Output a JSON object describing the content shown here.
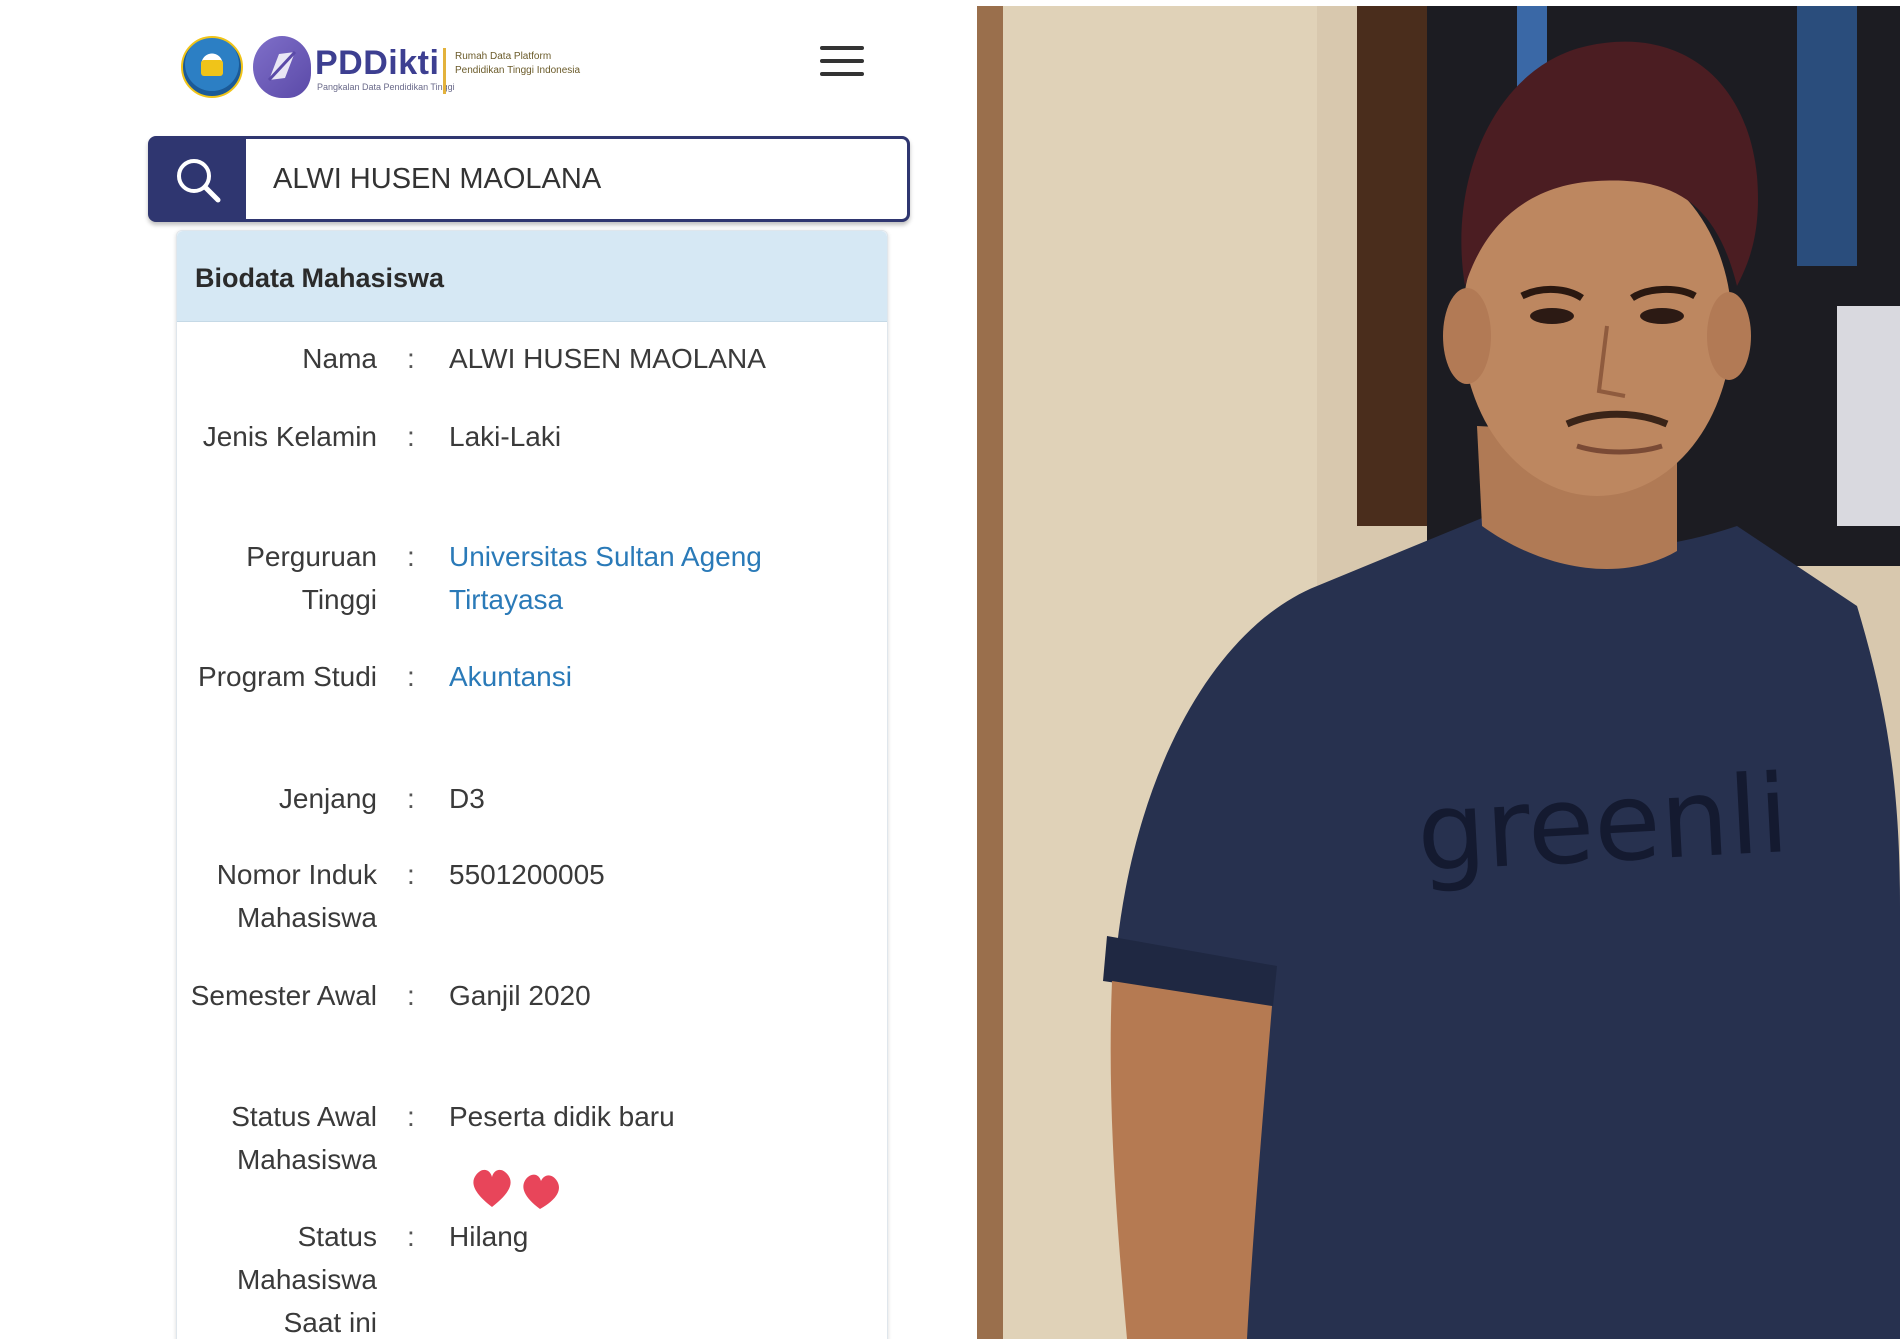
{
  "header": {
    "brand_name": "PDDikti",
    "brand_subtitle": "Pangkalan Data Pendidikan Tinggi",
    "brand_tagline": "Rumah Data Platform Pendidikan Tinggi Indonesia",
    "menu_icon": "hamburger-menu-icon"
  },
  "search": {
    "value": "ALWI HUSEN MAOLANA",
    "icon": "search-icon"
  },
  "card": {
    "title": "Biodata Mahasiswa",
    "rows": [
      {
        "label": "Nama",
        "value": "ALWI HUSEN MAOLANA"
      },
      {
        "label": "Jenis Kelamin",
        "value": "Laki-Laki"
      },
      {
        "label": "Perguruan Tinggi",
        "value": "Universitas Sultan Ageng Tirtayasa"
      },
      {
        "label": "Program Studi",
        "value": "Akuntansi"
      },
      {
        "label": "Jenjang",
        "value": "D3"
      },
      {
        "label": "Nomor Induk Mahasiswa",
        "value": "5501200005"
      },
      {
        "label": "Semester Awal",
        "value": "Ganjil 2020"
      },
      {
        "label": "Status Awal Mahasiswa",
        "value": "Peserta didik baru"
      },
      {
        "label": "Status Mahasiswa Saat ini",
        "value": "Hilang"
      }
    ]
  },
  "decoration": {
    "hearts_icon": "hearts-emoji-icon",
    "heart_color": "#e8455a"
  },
  "photo": {
    "shirt_text": "greenli"
  },
  "colors": {
    "primary": "#2f3670",
    "link": "#2a7ab8",
    "card_header": "#d6e8f4"
  }
}
